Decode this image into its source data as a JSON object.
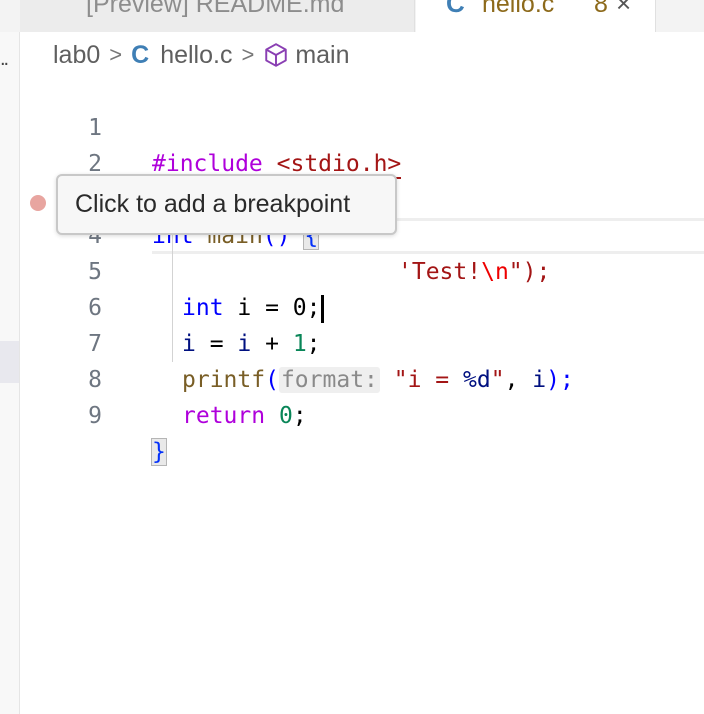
{
  "tabs": [
    {
      "label": "[Preview] README.md",
      "active": false
    },
    {
      "icon": "C",
      "label": "hello.c",
      "count": "8",
      "active": true
    }
  ],
  "left_strip": {
    "ellipsis": ".."
  },
  "breadcrumb": {
    "folder": "lab0",
    "file_icon": "C",
    "file": "hello.c",
    "symbol": "main",
    "separator": ">"
  },
  "tooltip": {
    "text": "Click to add a breakpoint"
  },
  "editor": {
    "line_numbers": [
      "1",
      "2",
      "3",
      "4",
      "5",
      "6",
      "7",
      "8",
      "9"
    ],
    "line1": {
      "directive": "#include",
      "header": "<stdio.h>"
    },
    "line3": {
      "type": "int",
      "name": "main",
      "parens": "()",
      "brace": "{"
    },
    "line4": {
      "visible_tail": "'Test!",
      "escape": "\\n",
      "close": "\");"
    },
    "line5": {
      "type": "int",
      "rest": " i = 0;"
    },
    "line6": {
      "lhs": "i",
      "op1": " = ",
      "rhs": "i",
      "op2": " + ",
      "num": "1",
      "end": ";"
    },
    "line7": {
      "fn": "printf",
      "open": "(",
      "hint": "format:",
      "str_open": "\"i = ",
      "fmt": "%d",
      "str_close": "\"",
      "comma": ", ",
      "arg": "i",
      "end": ");"
    },
    "line8": {
      "kw": "return",
      "num": "0",
      "end": ";"
    },
    "line9": {
      "brace": "}"
    }
  },
  "colors": {
    "keyword": "#af00db",
    "type": "#0000ff",
    "string": "#a31515",
    "number": "#098658",
    "function": "#795e26",
    "variable": "#001080",
    "breakpoint_hint": "#e8a5a0"
  }
}
